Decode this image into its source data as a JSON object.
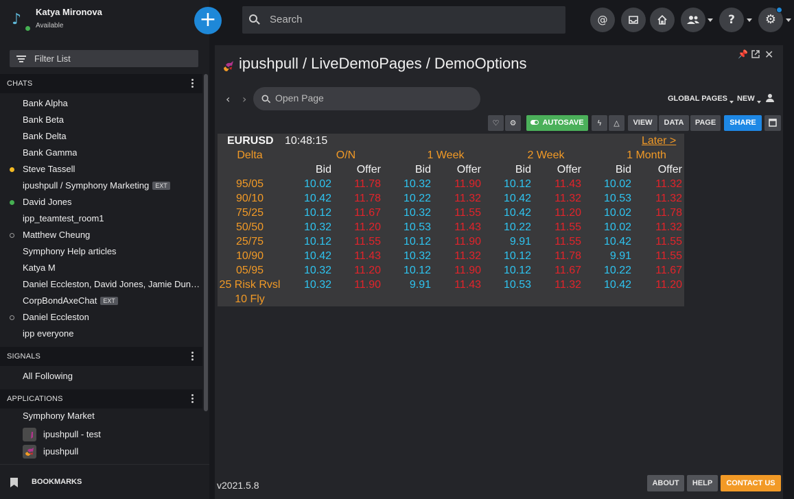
{
  "user": {
    "name": "Katya Mironova",
    "status": "Available"
  },
  "filter": {
    "label": "Filter List"
  },
  "search": {
    "placeholder": "Search"
  },
  "sections": {
    "chats": "CHATS",
    "signals": "SIGNALS",
    "applications": "APPLICATIONS"
  },
  "chats": [
    {
      "label": "Bank Alpha",
      "indicator": "none"
    },
    {
      "label": "Bank Beta",
      "indicator": "none"
    },
    {
      "label": "Bank Delta",
      "indicator": "none"
    },
    {
      "label": "Bank Gamma",
      "indicator": "none"
    },
    {
      "label": "Steve Tassell",
      "indicator": "yellow"
    },
    {
      "label": "ipushpull / Symphony Marketing",
      "indicator": "none",
      "ext": "EXT"
    },
    {
      "label": "David Jones",
      "indicator": "green"
    },
    {
      "label": "ipp_teamtest_room1",
      "indicator": "none"
    },
    {
      "label": "Matthew Cheung",
      "indicator": "hollow"
    },
    {
      "label": "Symphony Help articles",
      "indicator": "none"
    },
    {
      "label": "Katya M",
      "indicator": "none"
    },
    {
      "label": "Daniel Eccleston, David Jones, Jamie Duncan",
      "indicator": "none"
    },
    {
      "label": "CorpBondAxeChat",
      "indicator": "none",
      "ext": "EXT"
    },
    {
      "label": "Daniel Eccleston",
      "indicator": "hollow"
    },
    {
      "label": "ipp everyone",
      "indicator": "none"
    }
  ],
  "signals": [
    {
      "label": "All Following"
    }
  ],
  "applications": [
    {
      "label": "Symphony Market"
    },
    {
      "label": "ipushpull - test"
    },
    {
      "label": "ipushpull"
    }
  ],
  "bookmarks": {
    "label": "BOOKMARKS"
  },
  "colors": {
    "accent": "#1e88d8",
    "bid": "#2ec4f0",
    "offer": "#e3232a",
    "header": "#f29a26",
    "autosave": "#4bb05a"
  },
  "module": {
    "title": "ipushpull / LiveDemoPages / DemoOptions",
    "page_search_placeholder": "Open Page",
    "global_pages": "GLOBAL PAGES",
    "new": "NEW",
    "toolbar": {
      "autosave": "AUTOSAVE",
      "view": "VIEW",
      "data": "DATA",
      "page": "PAGE",
      "share": "SHARE"
    },
    "version": "v2021.5.8",
    "footer": {
      "about": "ABOUT",
      "help": "HELP",
      "contact": "CONTACT US"
    }
  },
  "grid": {
    "pair": "EURUSD",
    "time": "10:48:15",
    "later": "Later >",
    "delta_label": "Delta",
    "tenors": [
      "O/N",
      "1 Week",
      "2 Week",
      "1 Month"
    ],
    "bid_label": "Bid",
    "offer_label": "Offer",
    "rows": [
      {
        "label": "95/05",
        "values": [
          "10.02",
          "11.78",
          "10.32",
          "11.90",
          "10.12",
          "11.43",
          "10.02",
          "11.32"
        ]
      },
      {
        "label": "90/10",
        "values": [
          "10.42",
          "11.78",
          "10.22",
          "11.32",
          "10.42",
          "11.32",
          "10.53",
          "11.32"
        ]
      },
      {
        "label": "75/25",
        "values": [
          "10.12",
          "11.67",
          "10.32",
          "11.55",
          "10.42",
          "11.20",
          "10.02",
          "11.78"
        ]
      },
      {
        "label": "50/50",
        "values": [
          "10.32",
          "11.20",
          "10.53",
          "11.43",
          "10.22",
          "11.55",
          "10.02",
          "11.32"
        ]
      },
      {
        "label": "25/75",
        "values": [
          "10.12",
          "11.55",
          "10.12",
          "11.90",
          "9.91",
          "11.55",
          "10.42",
          "11.55"
        ]
      },
      {
        "label": "10/90",
        "values": [
          "10.42",
          "11.43",
          "10.32",
          "11.32",
          "10.12",
          "11.78",
          "9.91",
          "11.55"
        ]
      },
      {
        "label": "05/95",
        "values": [
          "10.32",
          "11.20",
          "10.12",
          "11.90",
          "10.12",
          "11.67",
          "10.22",
          "11.67"
        ]
      },
      {
        "label": "25 Risk Rvsl",
        "values": [
          "10.32",
          "11.90",
          "9.91",
          "11.43",
          "10.53",
          "11.32",
          "10.42",
          "11.20"
        ]
      },
      {
        "label": "10 Fly",
        "values": []
      }
    ]
  }
}
